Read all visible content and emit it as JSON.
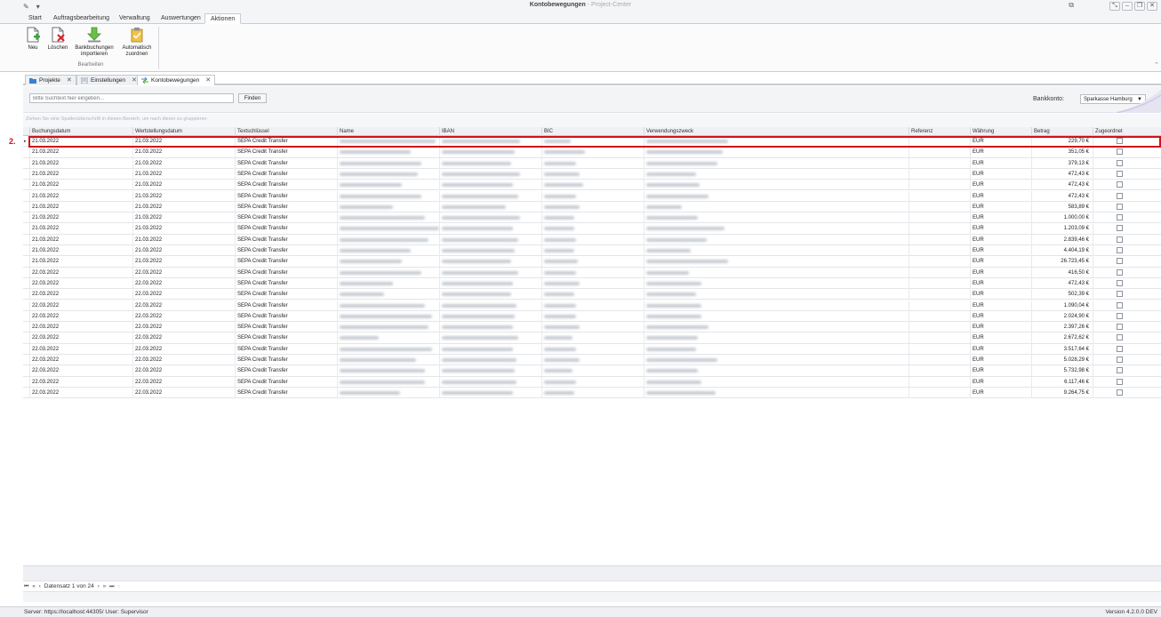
{
  "window": {
    "title": "Kontobewegungen",
    "app": "Project-Center",
    "separator": "-"
  },
  "ribbon": {
    "tabs": [
      "Start",
      "Auftragsbearbeitung",
      "Verwaltung",
      "Auswertungen",
      "Aktionen"
    ],
    "active_tab": "Aktionen",
    "group_name": "Bearbeiten",
    "buttons": {
      "new": "Neu",
      "delete": "Löschen",
      "import_line1": "Bankbuchungen",
      "import_line2": "importieren",
      "auto_line1": "Automatisch",
      "auto_line2": "zuordnen"
    }
  },
  "doc_tabs": [
    "Projekte",
    "Einstellungen",
    "Kontobewegungen"
  ],
  "search": {
    "placeholder": "Bitte Suchtext hier eingeben...",
    "find_label": "Finden",
    "bank_label": "Bankkonto:",
    "bank_value": "Sparkasse Hamburg"
  },
  "group_hint": "Ziehen Sie eine Spaltenüberschrift in diesen Bereich, um nach dieser zu gruppieren",
  "grid": {
    "columns": [
      "Buchungsdatum",
      "Wertstellungsdatum",
      "Textschlüssel",
      "Name",
      "IBAN",
      "BIC",
      "Verwendungszweck",
      "Referenz",
      "Währung",
      "Betrag",
      "Zugeordnet"
    ],
    "rows": [
      {
        "buchung": "21.03.2022",
        "wert": "21.03.2022",
        "text": "SEPA Credit Transfer",
        "waehrung": "EUR",
        "betrag": "229,70 €"
      },
      {
        "buchung": "21.03.2022",
        "wert": "21.03.2022",
        "text": "SEPA Credit Transfer",
        "waehrung": "EUR",
        "betrag": "351,05 €"
      },
      {
        "buchung": "21.03.2022",
        "wert": "21.03.2022",
        "text": "SEPA Credit Transfer",
        "waehrung": "EUR",
        "betrag": "379,13 €"
      },
      {
        "buchung": "21.03.2022",
        "wert": "21.03.2022",
        "text": "SEPA Credit Transfer",
        "waehrung": "EUR",
        "betrag": "472,43 €"
      },
      {
        "buchung": "21.03.2022",
        "wert": "21.03.2022",
        "text": "SEPA Credit Transfer",
        "waehrung": "EUR",
        "betrag": "472,43 €"
      },
      {
        "buchung": "21.03.2022",
        "wert": "21.03.2022",
        "text": "SEPA Credit Transfer",
        "waehrung": "EUR",
        "betrag": "472,43 €"
      },
      {
        "buchung": "21.03.2022",
        "wert": "21.03.2022",
        "text": "SEPA Credit Transfer",
        "waehrung": "EUR",
        "betrag": "583,89 €"
      },
      {
        "buchung": "21.03.2022",
        "wert": "21.03.2022",
        "text": "SEPA Credit Transfer",
        "waehrung": "EUR",
        "betrag": "1.000,00 €"
      },
      {
        "buchung": "21.03.2022",
        "wert": "21.03.2022",
        "text": "SEPA Credit Transfer",
        "waehrung": "EUR",
        "betrag": "1.203,09 €"
      },
      {
        "buchung": "21.03.2022",
        "wert": "21.03.2022",
        "text": "SEPA Credit Transfer",
        "waehrung": "EUR",
        "betrag": "2.839,46 €"
      },
      {
        "buchung": "21.03.2022",
        "wert": "21.03.2022",
        "text": "SEPA Credit Transfer",
        "waehrung": "EUR",
        "betrag": "4.404,19 €"
      },
      {
        "buchung": "21.03.2022",
        "wert": "21.03.2022",
        "text": "SEPA Credit Transfer",
        "waehrung": "EUR",
        "betrag": "26.723,45 €"
      },
      {
        "buchung": "22.03.2022",
        "wert": "22.03.2022",
        "text": "SEPA Credit Transfer",
        "waehrung": "EUR",
        "betrag": "416,50 €"
      },
      {
        "buchung": "22.03.2022",
        "wert": "22.03.2022",
        "text": "SEPA Credit Transfer",
        "waehrung": "EUR",
        "betrag": "472,43 €"
      },
      {
        "buchung": "22.03.2022",
        "wert": "22.03.2022",
        "text": "SEPA Credit Transfer",
        "waehrung": "EUR",
        "betrag": "502,39 €"
      },
      {
        "buchung": "22.03.2022",
        "wert": "22.03.2022",
        "text": "SEPA Credit Transfer",
        "waehrung": "EUR",
        "betrag": "1.090,04 €"
      },
      {
        "buchung": "22.03.2022",
        "wert": "22.03.2022",
        "text": "SEPA Credit Transfer",
        "waehrung": "EUR",
        "betrag": "2.024,90 €"
      },
      {
        "buchung": "22.03.2022",
        "wert": "22.03.2022",
        "text": "SEPA Credit Transfer",
        "waehrung": "EUR",
        "betrag": "2.397,26 €"
      },
      {
        "buchung": "22.03.2022",
        "wert": "22.03.2022",
        "text": "SEPA Credit Transfer",
        "waehrung": "EUR",
        "betrag": "2.672,62 €"
      },
      {
        "buchung": "22.03.2022",
        "wert": "22.03.2022",
        "text": "SEPA Credit Transfer",
        "waehrung": "EUR",
        "betrag": "3.517,64 €"
      },
      {
        "buchung": "22.03.2022",
        "wert": "22.03.2022",
        "text": "SEPA Credit Transfer",
        "waehrung": "EUR",
        "betrag": "5.028,29 €"
      },
      {
        "buchung": "22.03.2022",
        "wert": "22.03.2022",
        "text": "SEPA Credit Transfer",
        "waehrung": "EUR",
        "betrag": "5.732,98 €"
      },
      {
        "buchung": "22.03.2022",
        "wert": "22.03.2022",
        "text": "SEPA Credit Transfer",
        "waehrung": "EUR",
        "betrag": "6.117,46 €"
      },
      {
        "buchung": "22.03.2022",
        "wert": "22.03.2022",
        "text": "SEPA Credit Transfer",
        "waehrung": "EUR",
        "betrag": "9.264,75 €"
      }
    ]
  },
  "annotation": {
    "step_label": "2."
  },
  "navigator": {
    "record_text": "Datensatz 1 von 24"
  },
  "status": {
    "left": "Server: https://localhost:44305/   User: Supervisor",
    "right": "Version 4.2.0.0 DEV"
  },
  "icons": {
    "window_controls": [
      "restore-icon",
      "minimize-icon",
      "maximize-icon",
      "close-icon"
    ]
  },
  "colors": {
    "accent_red": "#d0121b",
    "ribbon_green": "#4caf33"
  }
}
